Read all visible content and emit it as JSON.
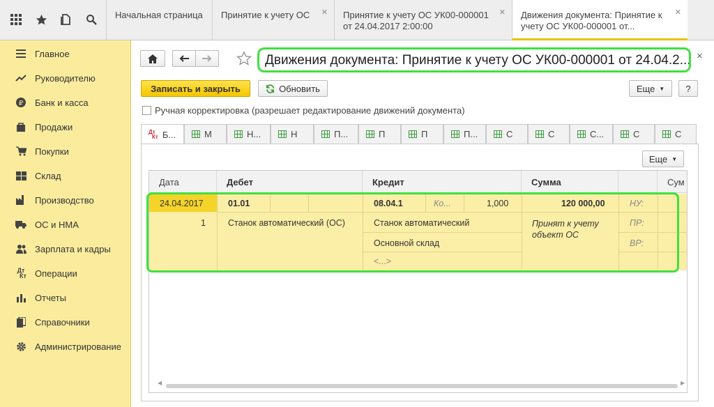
{
  "toolbar_icons": [
    "grid-icon",
    "star-icon",
    "history-icon",
    "search-icon"
  ],
  "tabs": [
    {
      "label": "Начальная страница",
      "closable": false
    },
    {
      "label": "Принятие к учету ОС",
      "closable": true
    },
    {
      "label": "Принятие к учету ОС УК00-000001 от 24.04.2017 2:00:00",
      "closable": true
    },
    {
      "label": "Движения документа: Принятие к учету ОС УК00-000001 от...",
      "closable": true,
      "active": true
    }
  ],
  "sidebar": {
    "items": [
      {
        "label": "Главное",
        "icon": "menu-icon"
      },
      {
        "label": "Руководителю",
        "icon": "trend-icon"
      },
      {
        "label": "Банк и касса",
        "icon": "ruble-icon"
      },
      {
        "label": "Продажи",
        "icon": "bag-icon"
      },
      {
        "label": "Покупки",
        "icon": "cart-icon"
      },
      {
        "label": "Склад",
        "icon": "warehouse-icon"
      },
      {
        "label": "Производство",
        "icon": "factory-icon"
      },
      {
        "label": "ОС и НМА",
        "icon": "truck-icon"
      },
      {
        "label": "Зарплата и кадры",
        "icon": "people-icon"
      },
      {
        "label": "Операции",
        "icon": "dt-kt-icon"
      },
      {
        "label": "Отчеты",
        "icon": "bar-chart-icon"
      },
      {
        "label": "Справочники",
        "icon": "books-icon"
      },
      {
        "label": "Администрирование",
        "icon": "gear-icon"
      }
    ]
  },
  "form": {
    "title": "Движения документа: Принятие к учету ОС УК00-000001 от 24.04.2...",
    "save_close": "Записать и закрыть",
    "refresh": "Обновить",
    "more": "Еще",
    "help": "?",
    "close": "×",
    "manual_edit_label": "Ручная корректировка (разрешает редактирование движений документа)",
    "manual_edit_checked": false
  },
  "ledger_tabs": [
    {
      "label": "Б...",
      "active": true
    },
    {
      "label": "М"
    },
    {
      "label": "Н..."
    },
    {
      "label": "Н"
    },
    {
      "label": "П..."
    },
    {
      "label": "П"
    },
    {
      "label": "П"
    },
    {
      "label": "П..."
    },
    {
      "label": "С"
    },
    {
      "label": "С"
    },
    {
      "label": "С..."
    },
    {
      "label": "С"
    },
    {
      "label": "С"
    }
  ],
  "grid": {
    "more": "Еще",
    "headers": [
      "Дата",
      "Дебет",
      "Кредит",
      "Сумма",
      "",
      "Сум"
    ],
    "row": {
      "date": "24.04.2017",
      "number": "1",
      "debit_account": "01.01",
      "debit_subconto": "Станок автоматический (ОС)",
      "credit_account": "08.04.1",
      "credit_qty_label": "Ко...",
      "credit_qty": "1,000",
      "credit_subconto1": "Станок автоматический",
      "credit_subconto2": "Основной склад",
      "credit_subconto3": "<...>",
      "amount": "120 000,00",
      "content": "Принят к учету объект ОС",
      "nu_label": "НУ:",
      "pr_label": "ПР:",
      "vr_label": "ВР:"
    }
  },
  "colors": {
    "sidebar_bg": "#fbec9d",
    "primary_button": "#f5c600",
    "highlight_outline": "#3fe03f",
    "row_bg": "#fbeea6"
  }
}
